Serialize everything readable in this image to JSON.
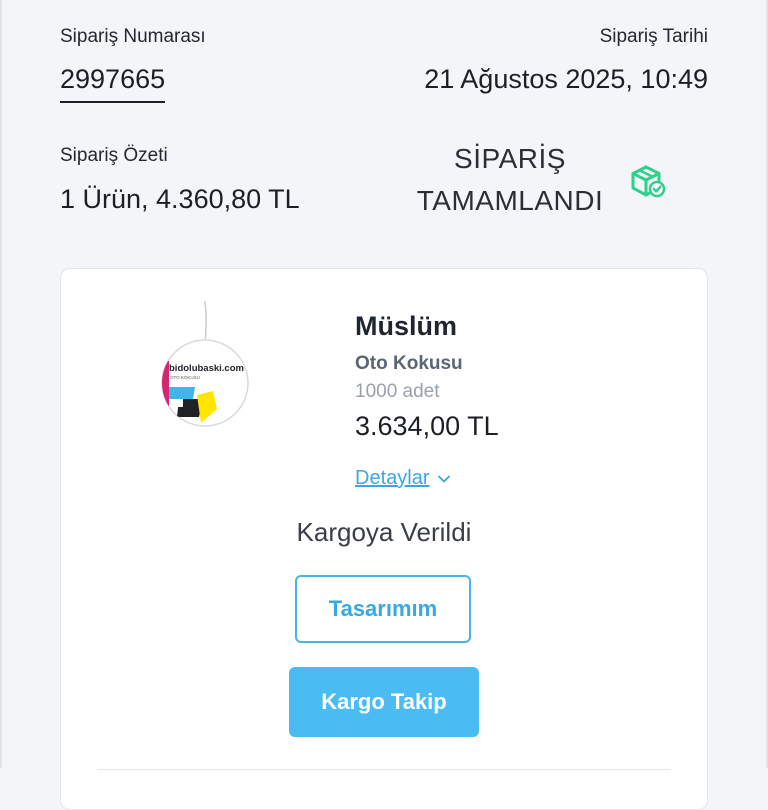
{
  "order": {
    "number_label": "Sipariş Numarası",
    "number": "2997665",
    "date_label": "Sipariş Tarihi",
    "date": "21 Ağustos 2025, 10:49",
    "summary_label": "Sipariş Özeti",
    "summary": "1 Ürün, 4.360,80 TL",
    "status": "SİPARİŞ TAMAMLANDI",
    "status_icon": "package-check-icon"
  },
  "product": {
    "name": "Müslüm",
    "category": "Oto Kokusu",
    "quantity": "1000 adet",
    "price": "3.634,00 TL",
    "details_label": "Detaylar",
    "image": {
      "brand": "bidolubaski.com",
      "subtitle": "OTO KOKUSU"
    }
  },
  "shipping": {
    "status": "Kargoya Verildi",
    "design_button": "Tasarımım",
    "track_button": "Kargo Takip"
  },
  "colors": {
    "accent": "#4bbcf2",
    "link": "#3aa8e0",
    "status_icon": "#2ed18b",
    "background": "#f3f5f8"
  }
}
